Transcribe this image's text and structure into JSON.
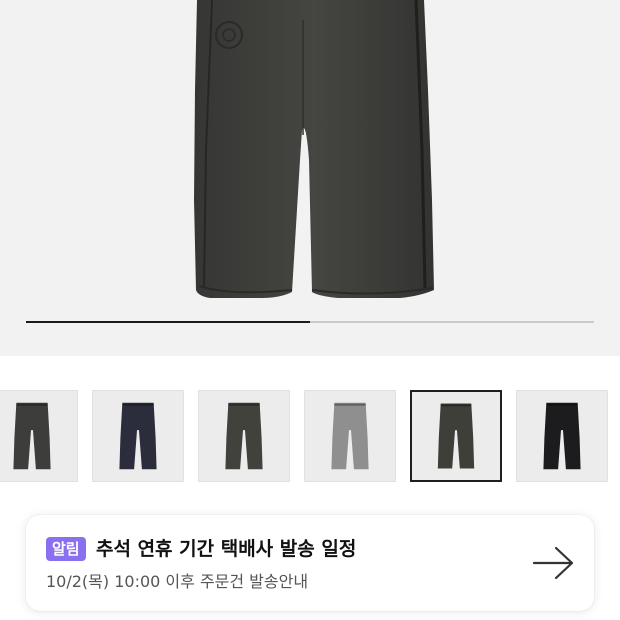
{
  "gallery": {
    "image_alt": "charcoal wide-leg sweatpants",
    "progress_fraction": 0.5,
    "thumbnails": [
      {
        "name": "thumb-charcoal",
        "color": "#3d3d3b"
      },
      {
        "name": "thumb-navy",
        "color": "#2b2d3d"
      },
      {
        "name": "thumb-dark-green",
        "color": "#41423c"
      },
      {
        "name": "thumb-grey",
        "color": "#8f8f8f"
      },
      {
        "name": "thumb-charcoal-selected",
        "color": "#3f3f39"
      },
      {
        "name": "thumb-black",
        "color": "#1c1c1e"
      }
    ],
    "selected_index": 4
  },
  "notice": {
    "badge": "알림",
    "title": "추석 연휴 기간 택배사 발송 일정",
    "subtitle": "10/2(목) 10:00 이후 주문건 발송안내",
    "arrow_icon": "arrow-right-icon",
    "badge_color": "#8a6ff0"
  }
}
